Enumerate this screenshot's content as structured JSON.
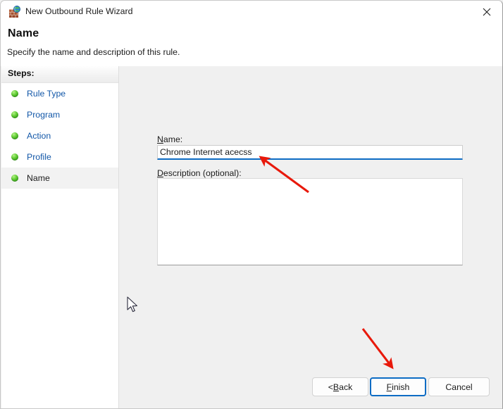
{
  "window": {
    "title": "New Outbound Rule Wizard",
    "icon": "firewall-wall-globe-icon",
    "close_label": "✕"
  },
  "header": {
    "title": "Name",
    "subtitle": "Specify the name and description of this rule."
  },
  "sidebar": {
    "header_label": "Steps:",
    "items": [
      {
        "label": "Rule Type",
        "state": "complete"
      },
      {
        "label": "Program",
        "state": "complete"
      },
      {
        "label": "Action",
        "state": "complete"
      },
      {
        "label": "Profile",
        "state": "complete"
      },
      {
        "label": "Name",
        "state": "current"
      }
    ]
  },
  "form": {
    "name_label_accel": "N",
    "name_label_rest": "ame:",
    "name_value": "Chrome Internet acecss",
    "name_placeholder": "",
    "description_label_accel": "D",
    "description_label_rest": "escription (optional):",
    "description_value": "",
    "description_placeholder": ""
  },
  "footer": {
    "back_prefix": "< ",
    "back_accel": "B",
    "back_rest": "ack",
    "finish_accel": "F",
    "finish_rest": "inish",
    "cancel_label": "Cancel"
  },
  "annotations": {
    "arrow_color": "#e8190b",
    "arrow_name_field": "arrow-pointing-to-name-field",
    "arrow_finish_button": "arrow-pointing-to-finish-button"
  },
  "colors": {
    "accent": "#0d6cc4",
    "link": "#1257a8",
    "bullet_green": "#3aa51a",
    "window_bg": "#f0f0f0",
    "panel_white": "#ffffff"
  }
}
